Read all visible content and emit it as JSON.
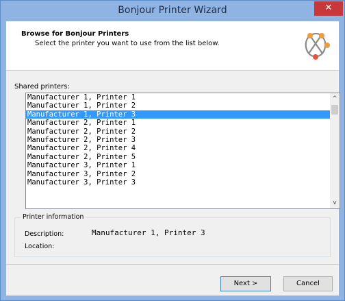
{
  "window": {
    "title": "Bonjour Printer Wizard",
    "close_glyph": "✕"
  },
  "header": {
    "title": "Browse for Bonjour Printers",
    "subtitle": "Select the printer you want to use from the list below.",
    "logo_icon": "bonjour-logo-icon"
  },
  "shared_printers": {
    "label": "Shared printers:",
    "items": [
      "Manufacturer 1, Printer 1",
      "Manufacturer 1, Printer 2",
      "Manufacturer 1, Printer 3",
      "Manufacturer 2, Printer 1",
      "Manufacturer 2, Printer 2",
      "Manufacturer 2, Printer 3",
      "Manufacturer 2, Printer 4",
      "Manufacturer 2, Printer 5",
      "Manufacturer 3, Printer 1",
      "Manufacturer 3, Printer 2",
      "Manufacturer 3, Printer 3"
    ],
    "selected_index": 2,
    "scroll_up_glyph": "^",
    "scroll_down_glyph": "v"
  },
  "printer_info": {
    "legend": "Printer information",
    "description_label": "Description:",
    "description_value": "Manufacturer 1, Printer 3",
    "location_label": "Location:",
    "location_value": ""
  },
  "buttons": {
    "next": "Next >",
    "cancel": "Cancel"
  },
  "colors": {
    "selection": "#3399ff",
    "close": "#c6383a",
    "titlebar": "#8fb4e3"
  }
}
